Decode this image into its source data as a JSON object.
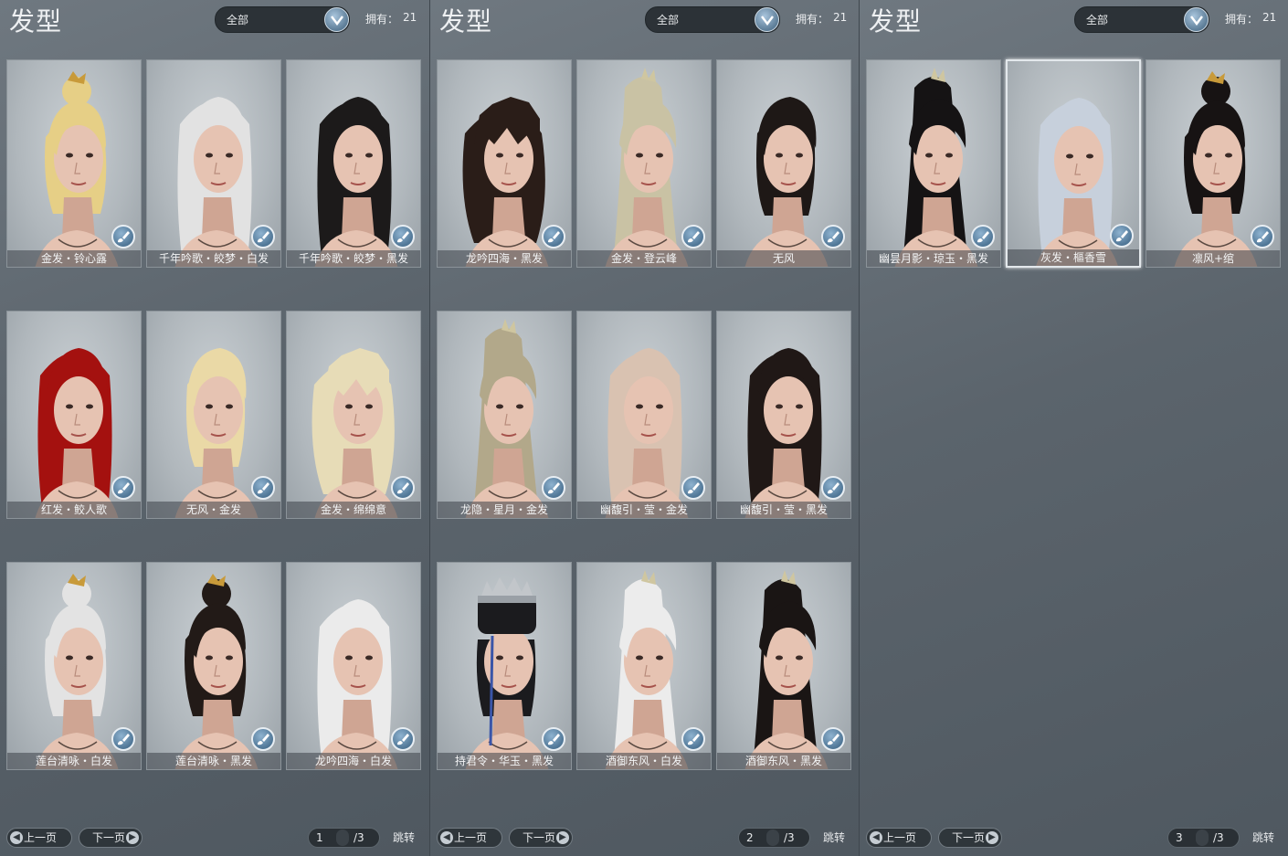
{
  "panels": [
    {
      "title": "发型",
      "filter": "全部",
      "owned_label": "拥有：",
      "owned_count": "21",
      "cards": [
        {
          "caption": "金发・铃心露",
          "hair": "#e6cf86",
          "style": "bun"
        },
        {
          "caption": "千年吟歌・皎梦・白发",
          "hair": "#e2e2e2",
          "style": "long"
        },
        {
          "caption": "千年吟歌・皎梦・黑发",
          "hair": "#1c1a1a",
          "style": "long"
        },
        {
          "caption": "龙吟四海・黑发",
          "hair": "#2a1d18",
          "style": "messy"
        },
        {
          "caption": "金发・登云峰",
          "hair": "#c9c2a4",
          "style": "tail"
        },
        {
          "caption": "无风",
          "hair": "#1e1816",
          "style": "short"
        },
        {
          "caption": "红发・鲛人歌",
          "hair": "#a4110f",
          "style": "long"
        },
        {
          "caption": "无风・金发",
          "hair": "#ead9a6",
          "style": "short"
        },
        {
          "caption": "金发・绵绵意",
          "hair": "#e7dcb7",
          "style": "messy"
        }
      ],
      "pager": {
        "prev": "上一页",
        "next": "下一页",
        "current": "1",
        "total": "/3",
        "jump": "跳转"
      }
    },
    {
      "title": "发型",
      "filter": "全部",
      "owned_label": "拥有：",
      "owned_count": "21",
      "cards": [
        {
          "caption": "龙吟四海・黑发",
          "hair": "#2a1d18",
          "style": "messy"
        },
        {
          "caption": "金发・登云峰",
          "hair": "#c9c2a4",
          "style": "tail"
        },
        {
          "caption": "无风",
          "hair": "#1e1816",
          "style": "short"
        },
        {
          "caption": "龙隐・星月・金发",
          "hair": "#b2a88a",
          "style": "tail"
        },
        {
          "caption": "幽馥引・莹・金发",
          "hair": "#d9c2b1",
          "style": "long"
        },
        {
          "caption": "幽馥引・莹・黑发",
          "hair": "#201816",
          "style": "long"
        },
        {
          "caption": "持君令・华玉・黑发",
          "hair": "#1b1b1e",
          "style": "hat"
        },
        {
          "caption": "酒御东风・白发",
          "hair": "#ececec",
          "style": "tail"
        },
        {
          "caption": "酒御东风・黑发",
          "hair": "#1a1514",
          "style": "tail"
        }
      ],
      "pager": {
        "prev": "上一页",
        "next": "下一页",
        "current": "2",
        "total": "/3",
        "jump": "跳转"
      }
    },
    {
      "title": "发型",
      "filter": "全部",
      "owned_label": "拥有：",
      "owned_count": "21",
      "cards": [
        {
          "caption": "幽昙月影・琼玉・黑发",
          "hair": "#151314",
          "style": "tail"
        },
        {
          "caption": "灰发・樞香雪",
          "hair": "#c7d0dc",
          "style": "long",
          "selected": true
        },
        {
          "caption": "凛风+绾",
          "hair": "#171313",
          "style": "bun"
        }
      ],
      "pager": {
        "prev": "上一页",
        "next": "下一页",
        "current": "3",
        "total": "/3",
        "jump": "跳转"
      }
    }
  ],
  "row_one_page_one": [
    {
      "caption": "金发・铃心露"
    },
    {
      "caption": "千年吟歌・皎梦・白发"
    },
    {
      "caption": "千年吟歌・皎梦・黑发"
    }
  ]
}
